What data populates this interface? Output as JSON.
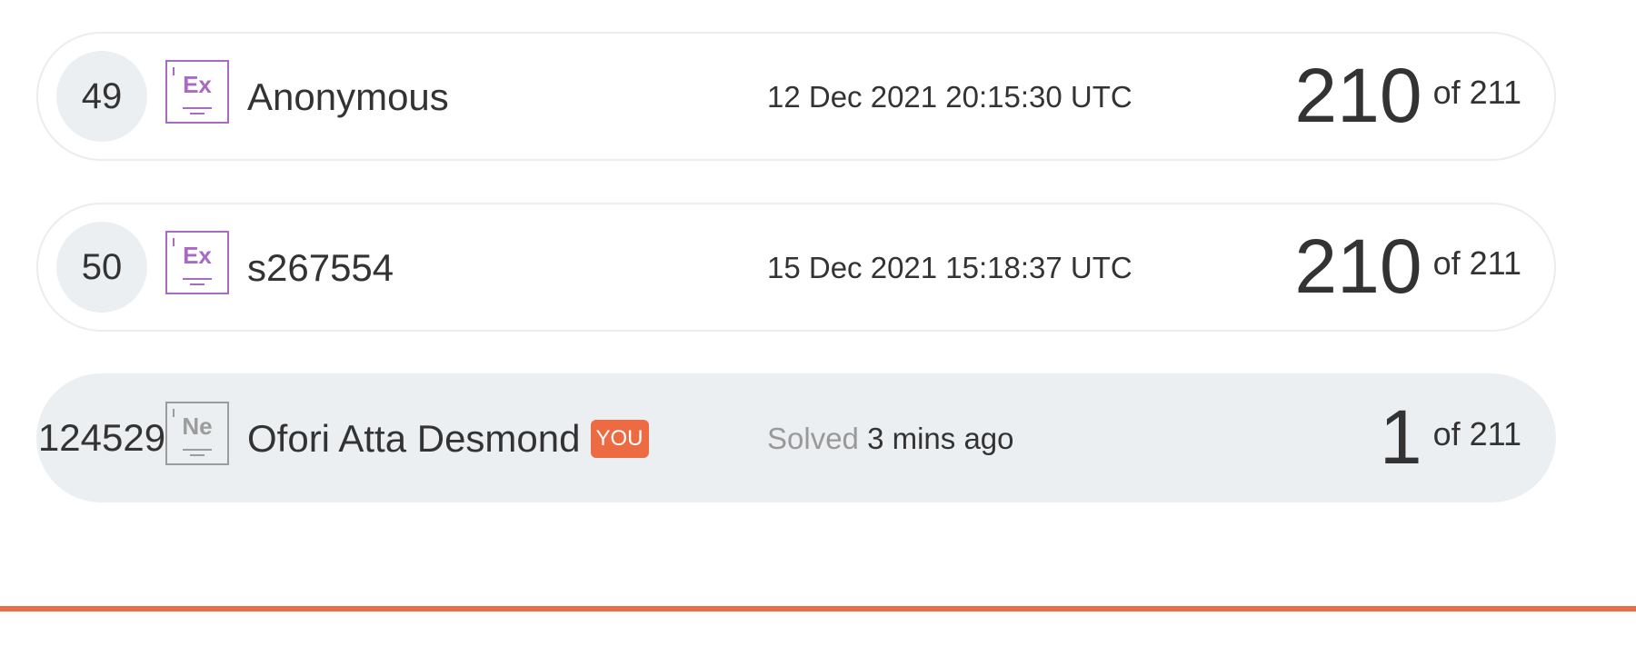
{
  "leaderboard": {
    "rows": [
      {
        "rank": "49",
        "badge_symbol": "Ex",
        "name": "Anonymous",
        "timestamp": "12 Dec 2021 20:15:30 UTC",
        "score": "210",
        "of_total": "of 211"
      },
      {
        "rank": "50",
        "badge_symbol": "Ex",
        "name": "s267554",
        "timestamp": "15 Dec 2021 15:18:37 UTC",
        "score": "210",
        "of_total": "of 211"
      }
    ],
    "current_user": {
      "rank": "124529",
      "badge_symbol": "Ne",
      "name": "Ofori Atta Desmond",
      "you_label": "YOU",
      "solved_label": "Solved",
      "solved_time": "3 mins ago",
      "score": "1",
      "of_total": "of 211"
    }
  },
  "colors": {
    "accent": "#ec6b43",
    "badge_purple": "#a86ac4",
    "badge_gray": "#9c9c9c",
    "row_highlight": "#eceff2",
    "rule": "#e96e45"
  },
  "icons": {
    "badge_icon": "periodic-element-badge-icon"
  }
}
